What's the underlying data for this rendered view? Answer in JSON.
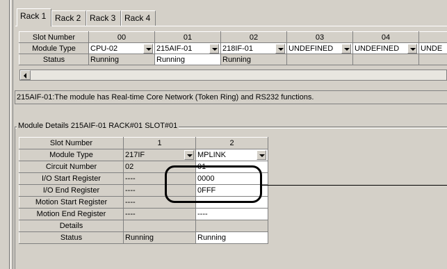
{
  "tabs": [
    "Rack 1",
    "Rack 2",
    "Rack 3",
    "Rack 4"
  ],
  "active_tab": "Rack 1",
  "rack_table": {
    "row_headers": [
      "Slot Number",
      "Module Type",
      "Status"
    ],
    "slots": [
      {
        "number": "00",
        "module": "CPU-02",
        "status": "Running"
      },
      {
        "number": "01",
        "module": "215AIF-01",
        "status": "Running"
      },
      {
        "number": "02",
        "module": "218IF-01",
        "status": "Running"
      },
      {
        "number": "03",
        "module": "UNDEFINED",
        "status": ""
      },
      {
        "number": "04",
        "module": "UNDEFINED",
        "status": ""
      },
      {
        "number": "",
        "module": "UNDE",
        "status": ""
      }
    ]
  },
  "description": "215AIF-01:The module has Real-time Core Network (Token Ring) and RS232 functions.",
  "details_title": "Module Details  215AIF-01  RACK#01  SLOT#01",
  "details_table": {
    "column_headers": [
      "1",
      "2"
    ],
    "rows": [
      {
        "label": "Slot Number",
        "c1": "1",
        "c2": "2"
      },
      {
        "label": "Module Type",
        "c1": "217IF",
        "c2": "MPLINK"
      },
      {
        "label": "Circuit Number",
        "c1": "02",
        "c2": "01"
      },
      {
        "label": "I/O Start Register",
        "c1": "----",
        "c2": "0000"
      },
      {
        "label": "I/O End Register",
        "c1": "----",
        "c2": "0FFF"
      },
      {
        "label": "Motion Start Register",
        "c1": "----",
        "c2": ""
      },
      {
        "label": "Motion End Register",
        "c1": "----",
        "c2": "----"
      },
      {
        "label": "Details",
        "c1": "",
        "c2": ""
      },
      {
        "label": "Status",
        "c1": "Running",
        "c2": "Running"
      }
    ]
  }
}
